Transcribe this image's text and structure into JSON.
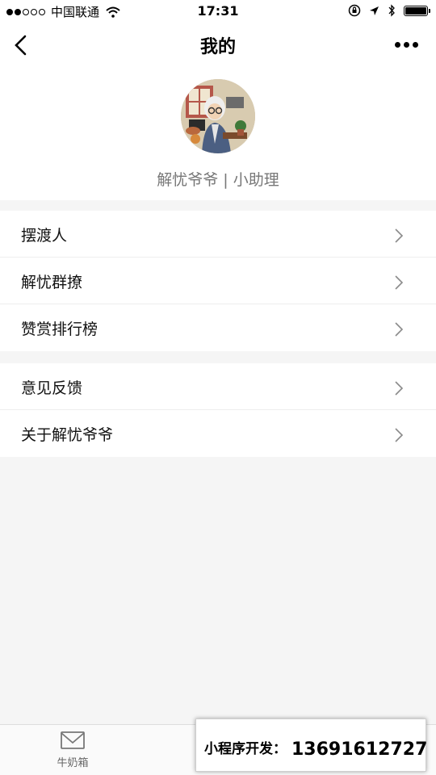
{
  "status_bar": {
    "carrier": "中国联通",
    "time": "17:31",
    "signal_filled": 2,
    "signal_total": 5
  },
  "nav": {
    "title": "我的",
    "back_icon": "chevron-left-icon",
    "more_icon": "more-dots-icon"
  },
  "profile": {
    "name": "解忧爷爷 | 小助理",
    "avatar_icon": "avatar-illustration"
  },
  "menu_groups": [
    {
      "items": [
        {
          "label": "摆渡人"
        },
        {
          "label": "解忧群撩"
        },
        {
          "label": "赞赏排行榜"
        }
      ]
    },
    {
      "items": [
        {
          "label": "意见反馈"
        },
        {
          "label": "关于解忧爷爷"
        }
      ]
    }
  ],
  "tab_bar": {
    "tabs": [
      {
        "label": "牛奶箱",
        "icon": "mail-icon"
      }
    ]
  },
  "promo": {
    "label": "小程序开发：",
    "phone": "13691612727"
  },
  "colors": {
    "page_background": "#f5f5f5",
    "card_background": "#ffffff",
    "secondary_text": "#777777"
  }
}
